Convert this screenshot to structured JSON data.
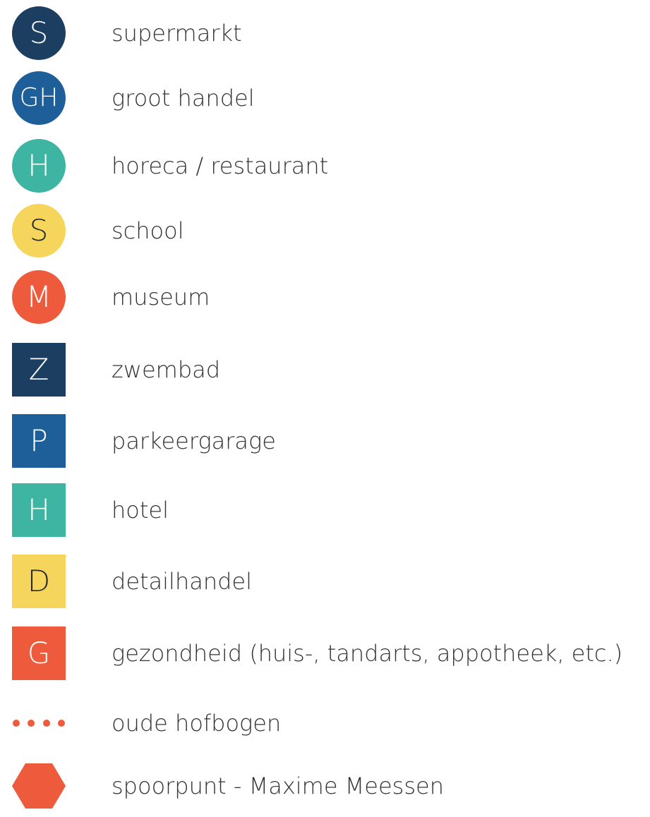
{
  "legend": {
    "items": [
      {
        "shape": "circle",
        "letter": "S",
        "color": "#1b3e61",
        "label": "supermarkt"
      },
      {
        "shape": "circle",
        "letter": "GH",
        "color": "#1f5f99",
        "label": "groot handel"
      },
      {
        "shape": "circle",
        "letter": "H",
        "color": "#3eb5a2",
        "label": "horeca / restaurant"
      },
      {
        "shape": "circle",
        "letter": "S",
        "color": "#f6d55c",
        "label": "school"
      },
      {
        "shape": "circle",
        "letter": "M",
        "color": "#ee5a3c",
        "label": "museum"
      },
      {
        "shape": "square",
        "letter": "Z",
        "color": "#1b3e61",
        "label": "zwembad"
      },
      {
        "shape": "square",
        "letter": "P",
        "color": "#1f5f99",
        "label": "parkeergarage"
      },
      {
        "shape": "square",
        "letter": "H",
        "color": "#3eb5a2",
        "label": "hotel"
      },
      {
        "shape": "square",
        "letter": "D",
        "color": "#f6d55c",
        "label": "detailhandel"
      },
      {
        "shape": "square",
        "letter": "G",
        "color": "#ee5a3c",
        "label": "gezondheid (huis-, tandarts, appotheek, etc.)"
      },
      {
        "shape": "dotted-line",
        "letter": "",
        "color": "#ee5a3c",
        "label": "oude hofbogen"
      },
      {
        "shape": "hexagon",
        "letter": "",
        "color": "#ee5a3c",
        "label": "spoorpunt - Maxime Meessen"
      }
    ]
  }
}
